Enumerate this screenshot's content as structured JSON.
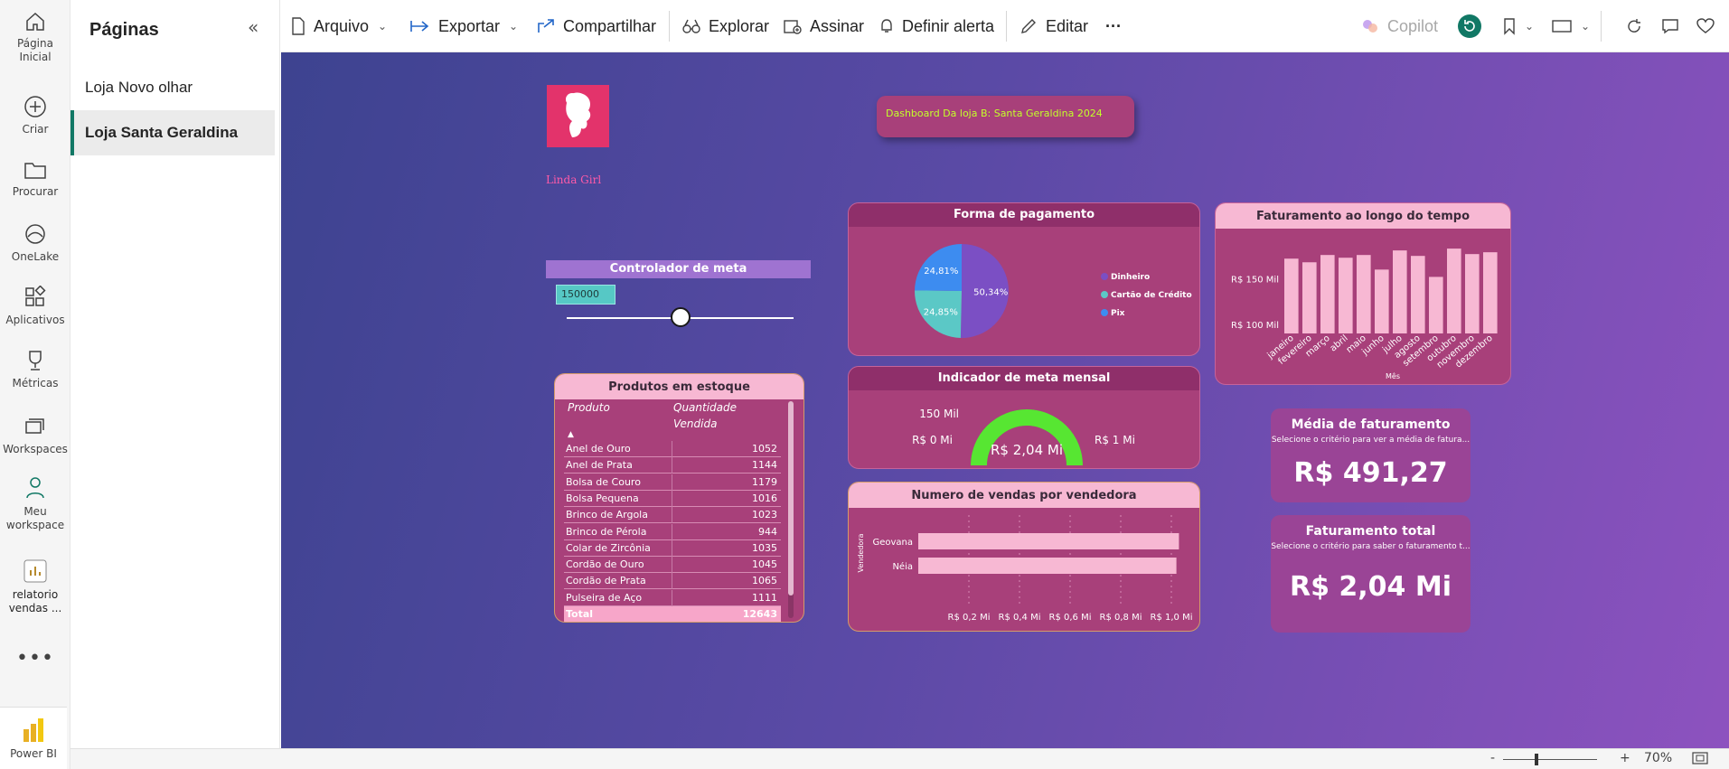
{
  "rail": {
    "items": [
      {
        "label1": "Página",
        "label2": "Inicial"
      },
      {
        "label1": "Criar",
        "label2": ""
      },
      {
        "label1": "Procurar",
        "label2": ""
      },
      {
        "label1": "OneLake",
        "label2": ""
      },
      {
        "label1": "Aplicativos",
        "label2": ""
      },
      {
        "label1": "Métricas",
        "label2": ""
      },
      {
        "label1": "Workspaces",
        "label2": ""
      },
      {
        "label1": "Meu",
        "label2": "workspace"
      },
      {
        "label1": "relatorio",
        "label2": "vendas ..."
      }
    ],
    "more": "•••",
    "app_label": "Power BI"
  },
  "pages": {
    "title": "Páginas",
    "items": [
      "Loja Novo olhar",
      "Loja Santa Geraldina"
    ]
  },
  "toolbar": {
    "arquivo": "Arquivo",
    "exportar": "Exportar",
    "compartilhar": "Compartilhar",
    "explorar": "Explorar",
    "assinar": "Assinar",
    "alerta": "Definir alerta",
    "editar": "Editar",
    "more": "···",
    "copilot": "Copilot"
  },
  "status": {
    "zoom": "70%",
    "minus": "-",
    "plus": "+"
  },
  "report": {
    "brand": "Linda Girl",
    "dash_title": "Dashboard Da loja B:  Santa Geraldina 2024",
    "meta_control": {
      "title": "Controlador de meta",
      "value": "150000",
      "slider_fraction": 0.5
    },
    "payment": {
      "title": "Forma de pagamento",
      "slices": [
        {
          "label": "Dinheiro",
          "percent_label": "50,34%",
          "value": 50.34,
          "color": "#7b4fc4"
        },
        {
          "label": "Cartão de Crédito",
          "percent_label": "24,85%",
          "value": 24.85,
          "color": "#5bc8c6"
        },
        {
          "label": "Pix",
          "percent_label": "24,81%",
          "value": 24.81,
          "color": "#3d8cf0"
        }
      ]
    },
    "revenue_time": {
      "title": "Faturamento ao longo do tempo",
      "xlabel": "Mês",
      "yticks": [
        "R$ 150 Mil",
        "R$ 100 Mil"
      ]
    },
    "stock": {
      "title": "Produtos em estoque",
      "col1": "Produto",
      "col2a": "Quantidade",
      "col2b": "Vendida",
      "sort_icon": "▲",
      "rows": [
        {
          "p": "Anel de Ouro",
          "q": "1052"
        },
        {
          "p": "Anel de Prata",
          "q": "1144"
        },
        {
          "p": "Bolsa de Couro",
          "q": "1179"
        },
        {
          "p": "Bolsa Pequena",
          "q": "1016"
        },
        {
          "p": "Brinco de Argola",
          "q": "1023"
        },
        {
          "p": "Brinco de Pérola",
          "q": "944"
        },
        {
          "p": "Colar de Zircônia",
          "q": "1035"
        },
        {
          "p": "Cordão de Ouro",
          "q": "1045"
        },
        {
          "p": "Cordão de Prata",
          "q": "1065"
        },
        {
          "p": "Pulseira de Aço",
          "q": "1111"
        }
      ],
      "total_label": "Total",
      "total_value": "12643"
    },
    "gauge": {
      "title": "Indicador de meta mensal",
      "target_label": "150 Mil",
      "min_label": "R$ 0 Mi",
      "max_label": "R$ 1 Mi",
      "value_label": "R$ 2,04 Mi",
      "fill_fraction": 1.0
    },
    "sellers": {
      "title": "Numero de vendas por vendedora",
      "ylabel": "Vendedora",
      "xticks": [
        "R$ 0,2 Mi",
        "R$ 0,4 Mi",
        "R$ 0,6 Mi",
        "R$ 0,8 Mi",
        "R$ 1,0 Mi"
      ]
    },
    "kpi_avg": {
      "title": "Média de faturamento",
      "subtitle": "Selecione o critério para ver a média de fatura...",
      "value": "R$ 491,27"
    },
    "kpi_total": {
      "title": "Faturamento total",
      "subtitle": "Selecione o critério para saber o faturamento t...",
      "value": "R$ 2,04 Mi"
    }
  },
  "chart_data": [
    {
      "type": "pie",
      "title": "Forma de pagamento",
      "categories": [
        "Dinheiro",
        "Cartão de Crédito",
        "Pix"
      ],
      "values": [
        50.34,
        24.85,
        24.81
      ],
      "legend": "right"
    },
    {
      "type": "bar",
      "title": "Faturamento ao longo do tempo",
      "xlabel": "Mês",
      "categories": [
        "janeiro",
        "fevereiro",
        "março",
        "abril",
        "maio",
        "junho",
        "julho",
        "agosto",
        "setembro",
        "outubro",
        "novembro",
        "dezembro"
      ],
      "values": [
        172000,
        168000,
        176000,
        173000,
        176000,
        160000,
        181000,
        175000,
        152000,
        183000,
        177000,
        179000
      ],
      "ylim": [
        90000,
        195000
      ],
      "yticks": [
        150000,
        100000
      ]
    },
    {
      "type": "bar",
      "orientation": "horizontal",
      "title": "Numero de vendas por vendedora",
      "ylabel": "Vendedora",
      "categories": [
        "Geovana",
        "Néia"
      ],
      "values": [
        1.03,
        1.02
      ],
      "xlim": [
        0,
        1.1
      ],
      "xticks": [
        0.2,
        0.4,
        0.6,
        0.8,
        1.0
      ]
    }
  ]
}
